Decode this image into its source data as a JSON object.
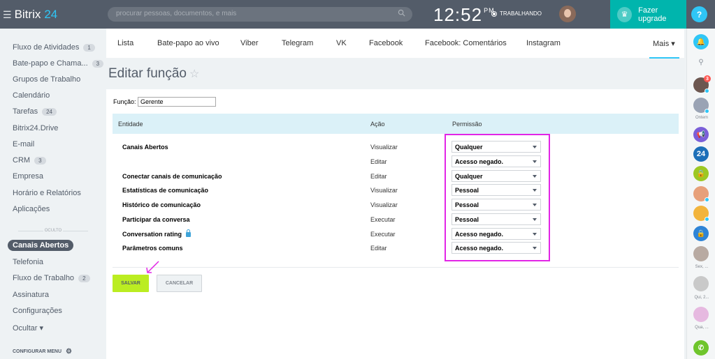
{
  "header": {
    "logo_text": "Bitrix",
    "logo_num": "24",
    "search_placeholder": "procurar pessoas, documentos, e mais",
    "time": "12:52",
    "time_suffix": "PM",
    "status": "TRABALHANDO",
    "upgrade_label": "Fazer upgrade",
    "help_label": "?"
  },
  "sidebar": {
    "items": [
      {
        "label": "Fluxo de Atividades",
        "count": "1"
      },
      {
        "label": "Bate-papo e Chama...",
        "count": "3"
      },
      {
        "label": "Grupos de Trabalho",
        "count": ""
      },
      {
        "label": "Calendário",
        "count": ""
      },
      {
        "label": "Tarefas",
        "count": "24"
      },
      {
        "label": "Bitrix24.Drive",
        "count": ""
      },
      {
        "label": "E-mail",
        "count": ""
      },
      {
        "label": "CRM",
        "count": "3"
      },
      {
        "label": "Empresa",
        "count": ""
      },
      {
        "label": "Horário e Relatórios",
        "count": ""
      },
      {
        "label": "Aplicações",
        "count": ""
      }
    ],
    "hidden_label": "OCULTO",
    "hidden_items": [
      {
        "label": "Canais Abertos",
        "count": "",
        "active": true
      },
      {
        "label": "Telefonia",
        "count": ""
      },
      {
        "label": "Fluxo de Trabalho",
        "count": "2"
      },
      {
        "label": "Assinatura",
        "count": ""
      },
      {
        "label": "Configurações",
        "count": ""
      },
      {
        "label": "Ocultar ▾",
        "count": ""
      }
    ],
    "config_label": "CONFIGURAR MENU"
  },
  "tabs": [
    "Lista",
    "Bate-papo ao vivo",
    "Viber",
    "Telegram",
    "VK",
    "Facebook",
    "Facebook: Comentários",
    "Instagram",
    "Mais ▾"
  ],
  "page": {
    "title": "Editar função",
    "funcao_label": "Função:",
    "funcao_value": "Gerente"
  },
  "table": {
    "headers": [
      "Entidade",
      "Ação",
      "Permissão"
    ],
    "rows": [
      {
        "entity": "Canais Abertos",
        "action": "Visualizar",
        "permission": "Qualquer",
        "locked": false
      },
      {
        "entity": "",
        "action": "Editar",
        "permission": "Acesso negado.",
        "locked": false
      },
      {
        "entity": "Conectar canais de comunicação",
        "action": "Editar",
        "permission": "Qualquer",
        "locked": false
      },
      {
        "entity": "Estatísticas de comunicação",
        "action": "Visualizar",
        "permission": "Pessoal",
        "locked": false
      },
      {
        "entity": "Histórico de comunicação",
        "action": "Visualizar",
        "permission": "Pessoal",
        "locked": false
      },
      {
        "entity": "Participar da conversa",
        "action": "Executar",
        "permission": "Pessoal",
        "locked": false
      },
      {
        "entity": "Conversation rating",
        "action": "Executar",
        "permission": "Acesso negado.",
        "locked": true
      },
      {
        "entity": "Parâmetros comuns",
        "action": "Editar",
        "permission": "Acesso negado.",
        "locked": false
      }
    ]
  },
  "buttons": {
    "save": "SALVAR",
    "cancel": "CANCELAR"
  },
  "right_bar": {
    "label_ontem": "Ontem",
    "label_sex": "Sex, ...",
    "label_qui": "Qui, 2...",
    "label_qua": "Qua, ...",
    "badge_count": "3",
    "icon_24": "24"
  },
  "colors": {
    "topbar": "#535c69",
    "upgrade": "#00b5ad",
    "accent": "#2fc6f6",
    "save_button": "#bbed21",
    "highlight": "#e225e6",
    "table_header": "#dbf1f8"
  }
}
